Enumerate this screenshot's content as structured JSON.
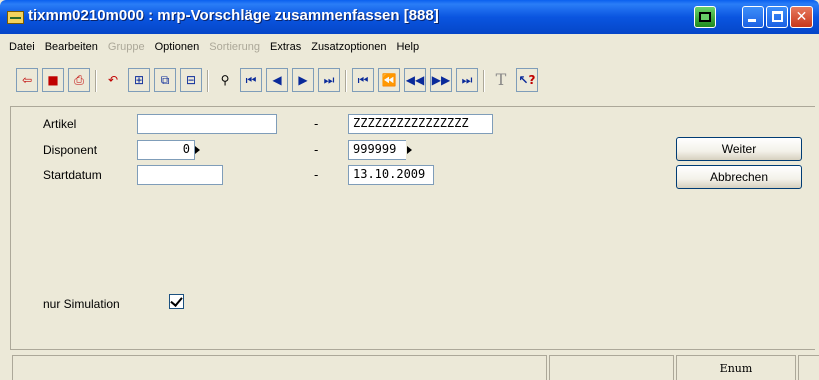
{
  "window": {
    "title": "tixmm0210m000 : mrp-Vorschläge zusammenfassen [888]"
  },
  "menu": [
    {
      "label": "Datei",
      "enabled": true
    },
    {
      "label": "Bearbeiten",
      "enabled": true
    },
    {
      "label": "Gruppe",
      "enabled": false
    },
    {
      "label": "Optionen",
      "enabled": true
    },
    {
      "label": "Sortierung",
      "enabled": false
    },
    {
      "label": "Extras",
      "enabled": true
    },
    {
      "label": "Zusatzoptionen",
      "enabled": true
    },
    {
      "label": "Help",
      "enabled": true
    }
  ],
  "toolbar": {
    "icons": [
      "exit-icon",
      "save-icon",
      "print-icon",
      "undo-icon",
      "insert-icon",
      "copy-icon",
      "duplicate-icon",
      "find-icon",
      "first-record-icon",
      "previous-record-icon",
      "next-record-icon",
      "last-record-icon",
      "first-group-icon",
      "previous-group-icon",
      "previous-page-icon",
      "next-page-icon",
      "last-group-icon",
      "text-icon",
      "help-icon"
    ],
    "text_glyph": "T",
    "help_glyph": "?"
  },
  "form": {
    "artikel": {
      "label": "Artikel",
      "from": "",
      "to": "ZZZZZZZZZZZZZZZZ"
    },
    "disponent": {
      "label": "Disponent",
      "from": "0",
      "to": "999999"
    },
    "startdatum": {
      "label": "Startdatum",
      "from": "",
      "to": "13.10.2009"
    },
    "range_separator": "-",
    "simulation": {
      "label": "nur Simulation",
      "checked": true
    }
  },
  "buttons": {
    "weiter": "Weiter",
    "abbrechen": "Abbrechen"
  },
  "statusbar": {
    "cells": [
      "",
      "",
      "Enum",
      ""
    ]
  },
  "colors": {
    "titlebar": "#0a55e0",
    "window_bg": "#ece9d8",
    "field_border": "#7f9db9"
  }
}
